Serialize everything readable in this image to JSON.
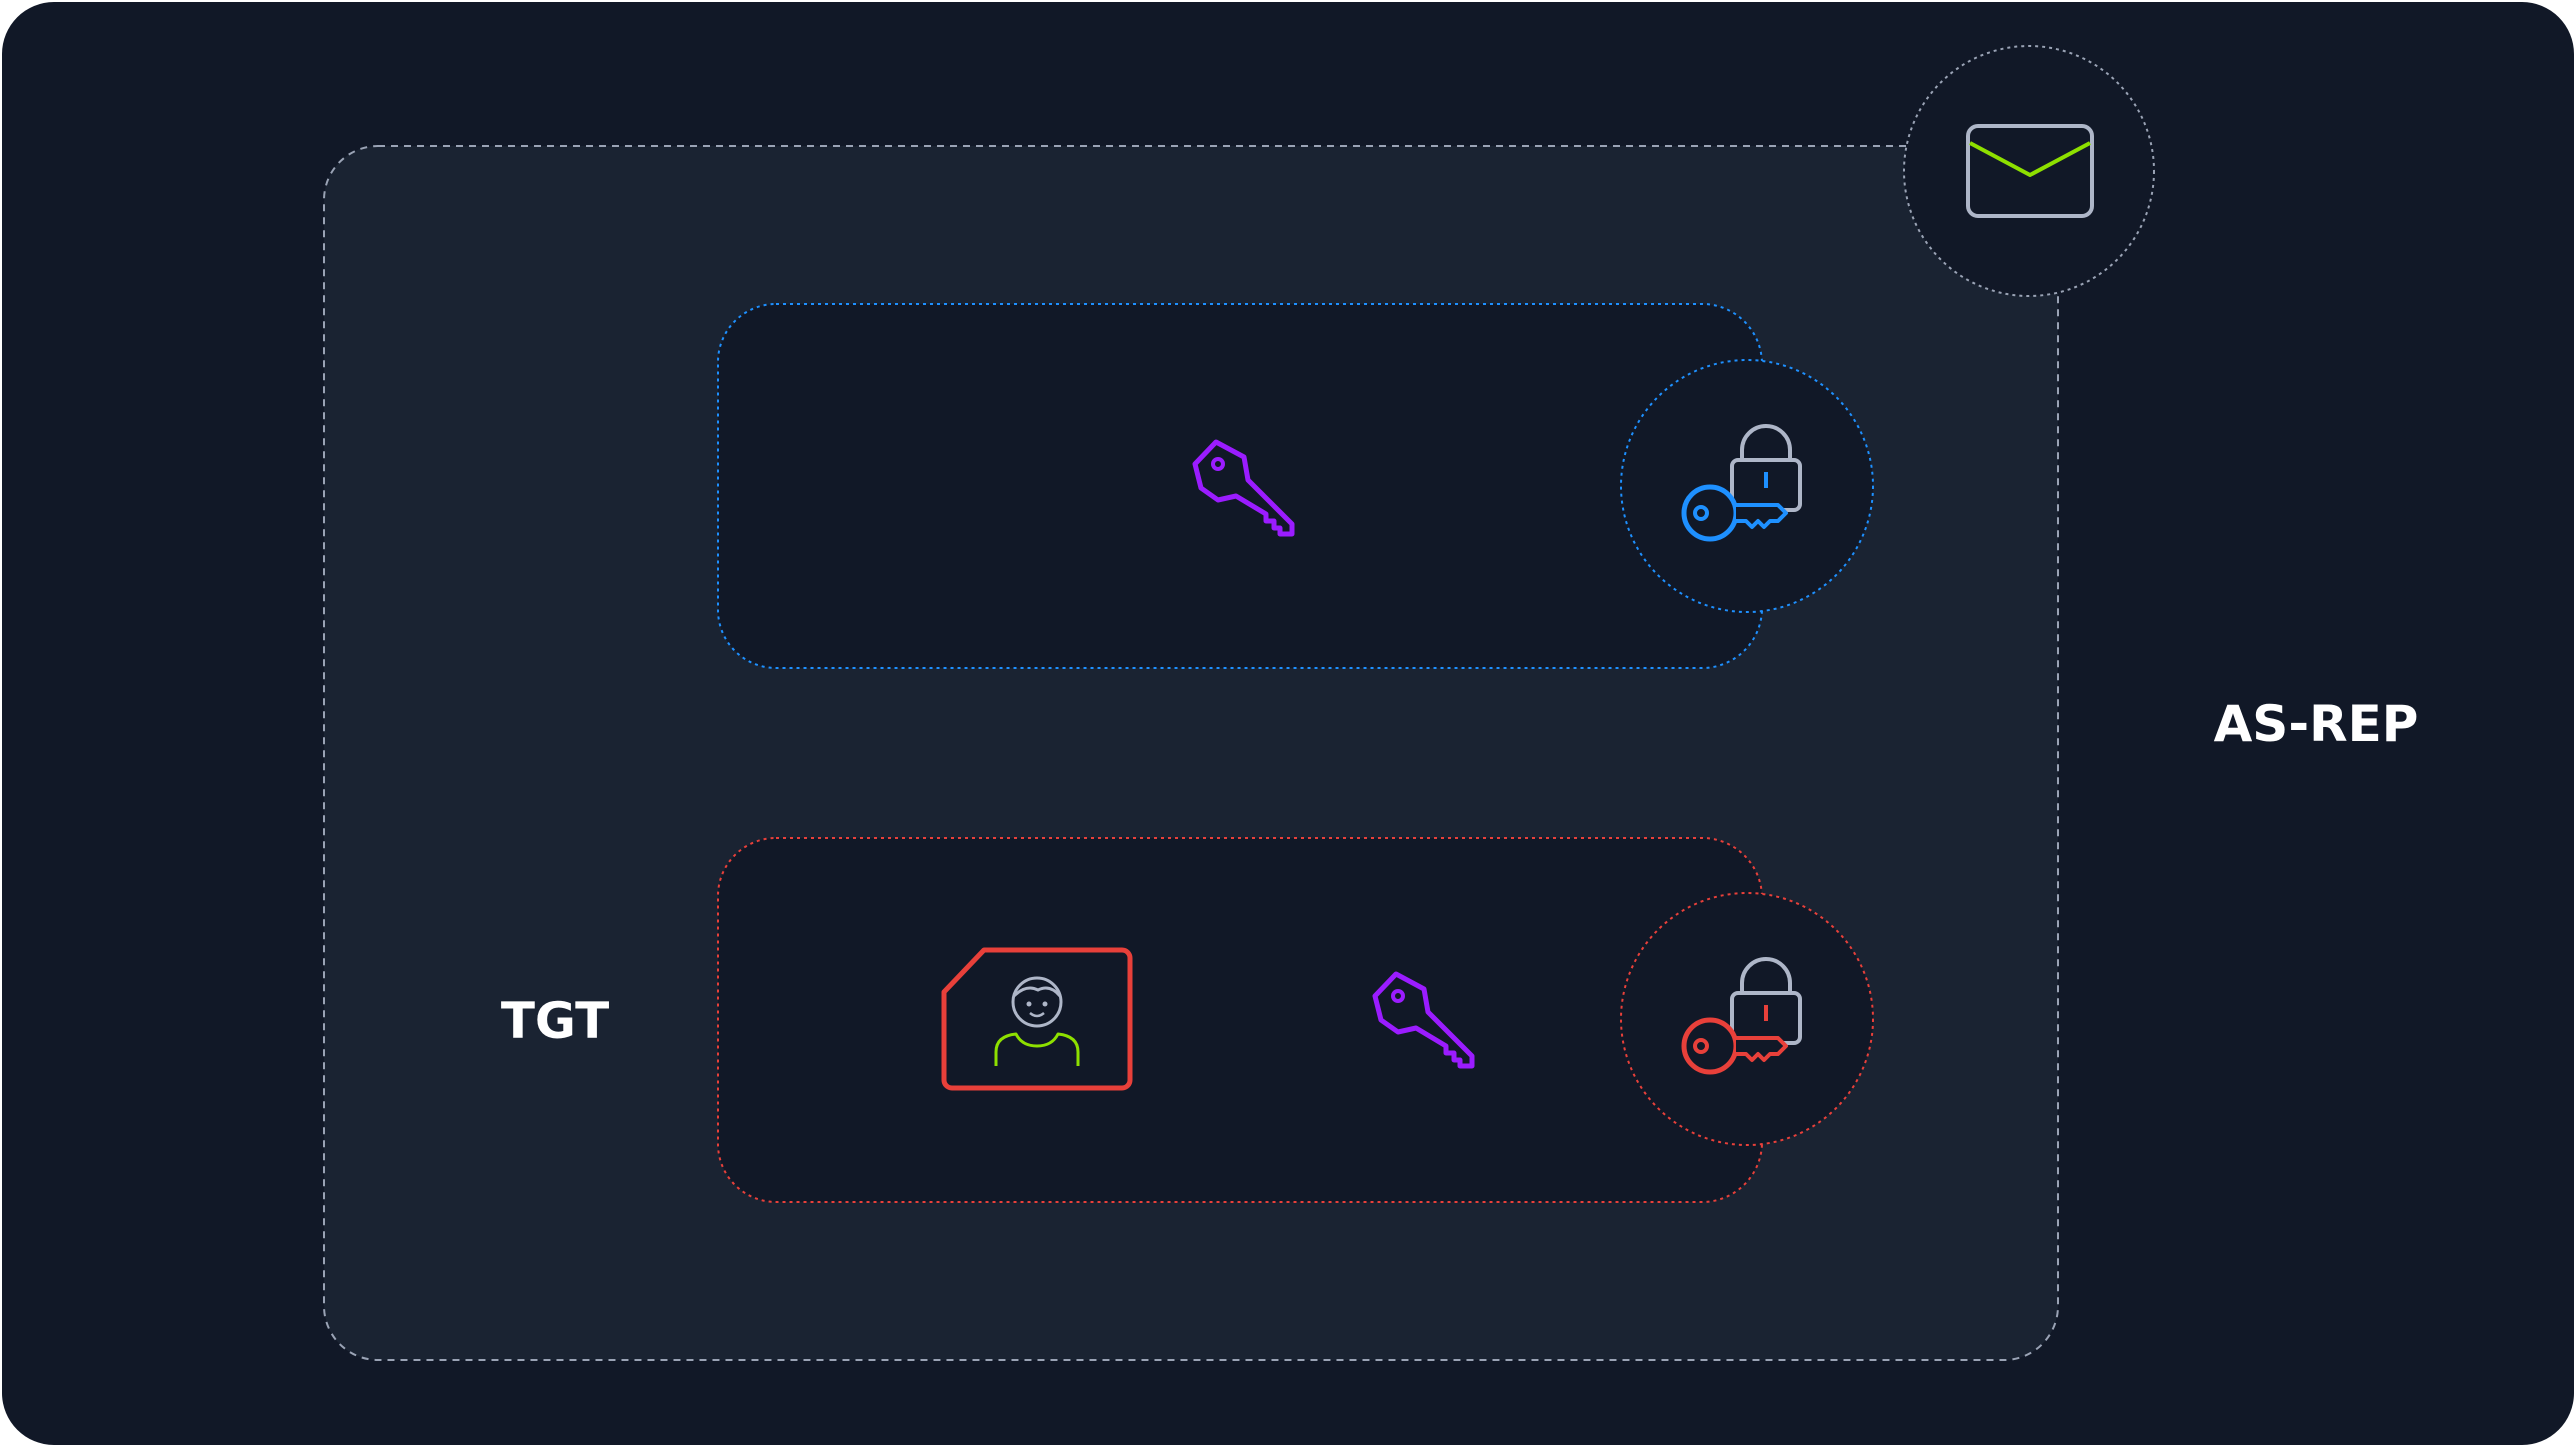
{
  "diagram": {
    "outer_label": "AS-REP",
    "ticket_label": "TGT",
    "colors": {
      "background": "#111827",
      "panel": "#1a2332",
      "card": "#111827",
      "blue_accent": "#1e90ff",
      "red_accent": "#e8403a",
      "purple_key": "#9b1cff",
      "green_accent": "#8ee000",
      "outline_grey": "#aeb6c8"
    },
    "elements": {
      "message": "envelope-icon",
      "session_key_box": [
        "session-key-icon",
        "blue-lock-key-icon"
      ],
      "tgt_box": [
        "user-id-card-icon",
        "session-key-icon",
        "red-lock-key-icon"
      ]
    }
  }
}
